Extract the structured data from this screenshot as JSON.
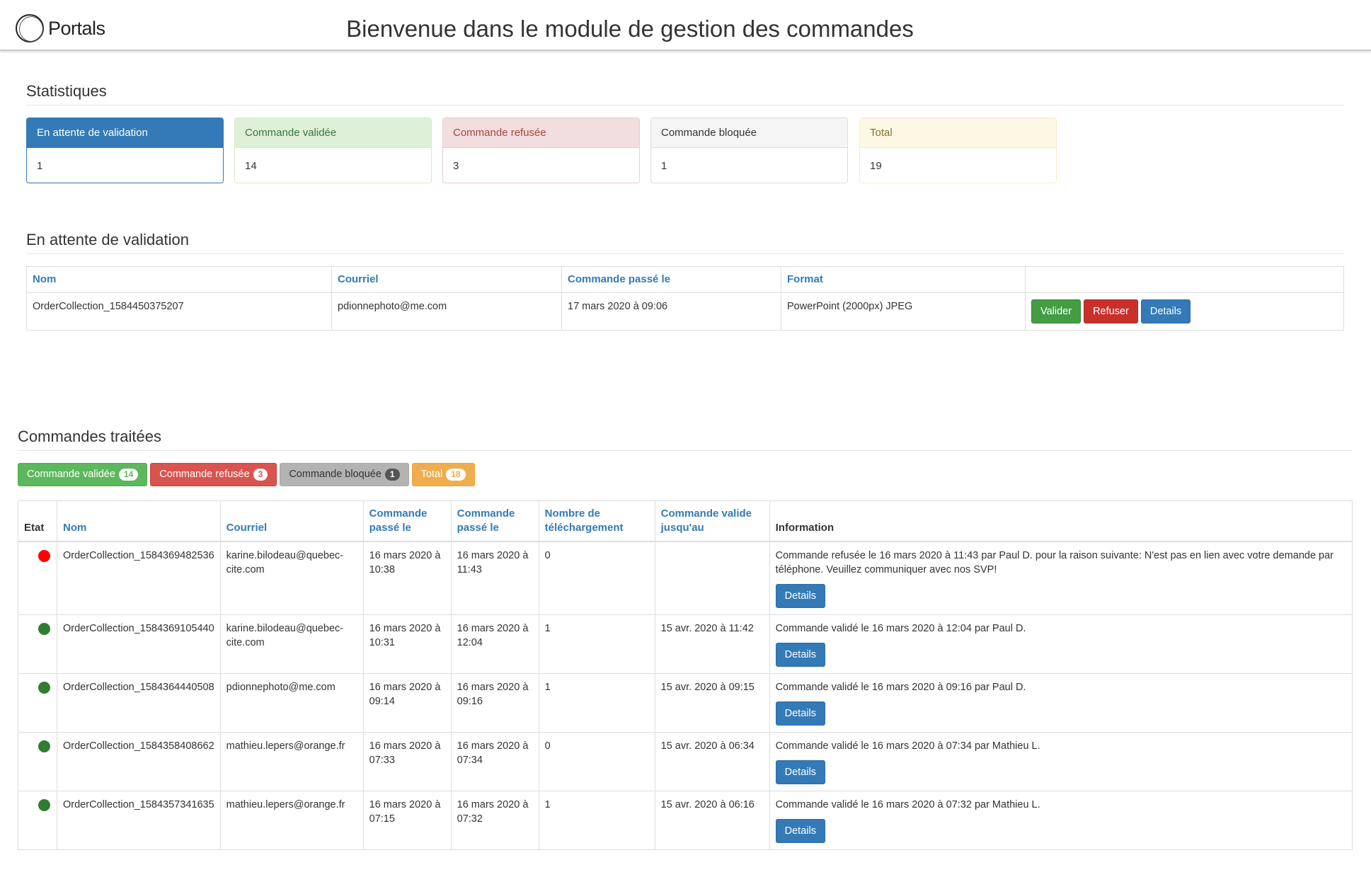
{
  "header": {
    "logo_text": "Portals",
    "title": "Bienvenue dans le module de gestion des commandes"
  },
  "stats": {
    "title": "Statistiques",
    "panels": [
      {
        "label": "En attente de validation",
        "value": "1"
      },
      {
        "label": "Commande validée",
        "value": "14"
      },
      {
        "label": "Commande refusée",
        "value": "3"
      },
      {
        "label": "Commande bloquée",
        "value": "1"
      },
      {
        "label": "Total",
        "value": "19"
      }
    ]
  },
  "pending": {
    "title": "En attente de validation",
    "columns": [
      "Nom",
      "Courriel",
      "Commande passé le",
      "Format",
      ""
    ],
    "rows": [
      {
        "nom": "OrderCollection_1584450375207",
        "courriel": "pdionnephoto@me.com",
        "date": "17 mars 2020 à 09:06",
        "format": "PowerPoint (2000px) JPEG"
      }
    ],
    "actions": {
      "validate": "Valider",
      "refuse": "Refuser",
      "details": "Details"
    }
  },
  "processed": {
    "title": "Commandes traitées",
    "filters": [
      {
        "label": "Commande validée",
        "count": "14"
      },
      {
        "label": "Commande refusée",
        "count": "3"
      },
      {
        "label": "Commande bloquée",
        "count": "1"
      },
      {
        "label": "Total",
        "count": "18"
      }
    ],
    "columns": {
      "etat": "Etat",
      "nom": "Nom",
      "courriel": "Courriel",
      "passe1": "Commande passé le",
      "passe2": "Commande passé le",
      "telechargement": "Nombre de téléchargement",
      "valide": "Commande valide jusqu'au",
      "information": "Information"
    },
    "details_label": "Details",
    "rows": [
      {
        "status": "refused",
        "status_color": "#ff0000",
        "nom": "OrderCollection_1584369482536",
        "courriel": "karine.bilodeau@quebec-cite.com",
        "passe1": "16 mars 2020 à 10:38",
        "passe2": "16 mars 2020 à 11:43",
        "telechargement": "0",
        "valide": "",
        "information": "Commande refusée le 16 mars 2020 à 11:43 par Paul D. pour la raison suivante: N'est pas en lien avec votre demande par téléphone. Veuillez communiquer avec nos SVP!"
      },
      {
        "status": "validated",
        "status_color": "#2e7d32",
        "nom": "OrderCollection_1584369105440",
        "courriel": "karine.bilodeau@quebec-cite.com",
        "passe1": "16 mars 2020 à 10:31",
        "passe2": "16 mars 2020 à 12:04",
        "telechargement": "1",
        "valide": "15 avr. 2020 à 11:42",
        "information": "Commande validé le 16 mars 2020 à 12:04 par Paul D."
      },
      {
        "status": "validated",
        "status_color": "#2e7d32",
        "nom": "OrderCollection_1584364440508",
        "courriel": "pdionnephoto@me.com",
        "passe1": "16 mars 2020 à 09:14",
        "passe2": "16 mars 2020 à 09:16",
        "telechargement": "1",
        "valide": "15 avr. 2020 à 09:15",
        "information": "Commande validé le 16 mars 2020 à 09:16 par Paul D."
      },
      {
        "status": "validated",
        "status_color": "#2e7d32",
        "nom": "OrderCollection_1584358408662",
        "courriel": "mathieu.lepers@orange.fr",
        "passe1": "16 mars 2020 à 07:33",
        "passe2": "16 mars 2020 à 07:34",
        "telechargement": "0",
        "valide": "15 avr. 2020 à 06:34",
        "information": "Commande validé le 16 mars 2020 à 07:34 par Mathieu L."
      },
      {
        "status": "validated",
        "status_color": "#2e7d32",
        "nom": "OrderCollection_1584357341635",
        "courriel": "mathieu.lepers@orange.fr",
        "passe1": "16 mars 2020 à 07:15",
        "passe2": "16 mars 2020 à 07:32",
        "telechargement": "1",
        "valide": "15 avr. 2020 à 06:16",
        "information": "Commande validé le 16 mars 2020 à 07:32 par Mathieu L."
      }
    ]
  }
}
